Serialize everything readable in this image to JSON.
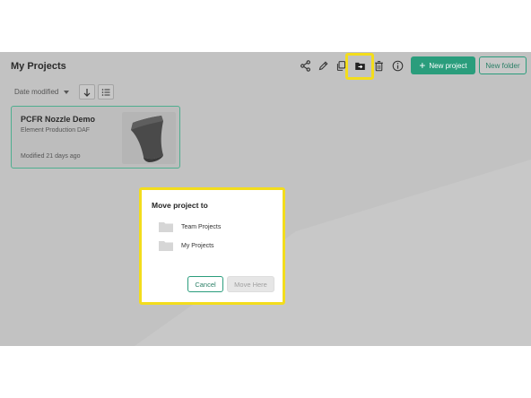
{
  "header": {
    "title": "My Projects",
    "new_project_label": "New project",
    "new_folder_label": "New folder",
    "icons": [
      "share-icon",
      "pencil-icon",
      "copy-icon",
      "move-folder-icon",
      "trash-icon",
      "info-icon"
    ]
  },
  "sort": {
    "label": "Date modified"
  },
  "project_card": {
    "title": "PCFR Nozzle Demo",
    "subtitle": "Element Production DAF",
    "modified": "Modified 21 days ago"
  },
  "dialog": {
    "title": "Move project to",
    "folders": [
      {
        "name": "Team Projects"
      },
      {
        "name": "My Projects"
      }
    ],
    "cancel_label": "Cancel",
    "move_label": "Move Here"
  },
  "colors": {
    "accent": "#2a9d7c",
    "highlight": "#f3dd1c",
    "overlay": "#c2c2c2"
  }
}
